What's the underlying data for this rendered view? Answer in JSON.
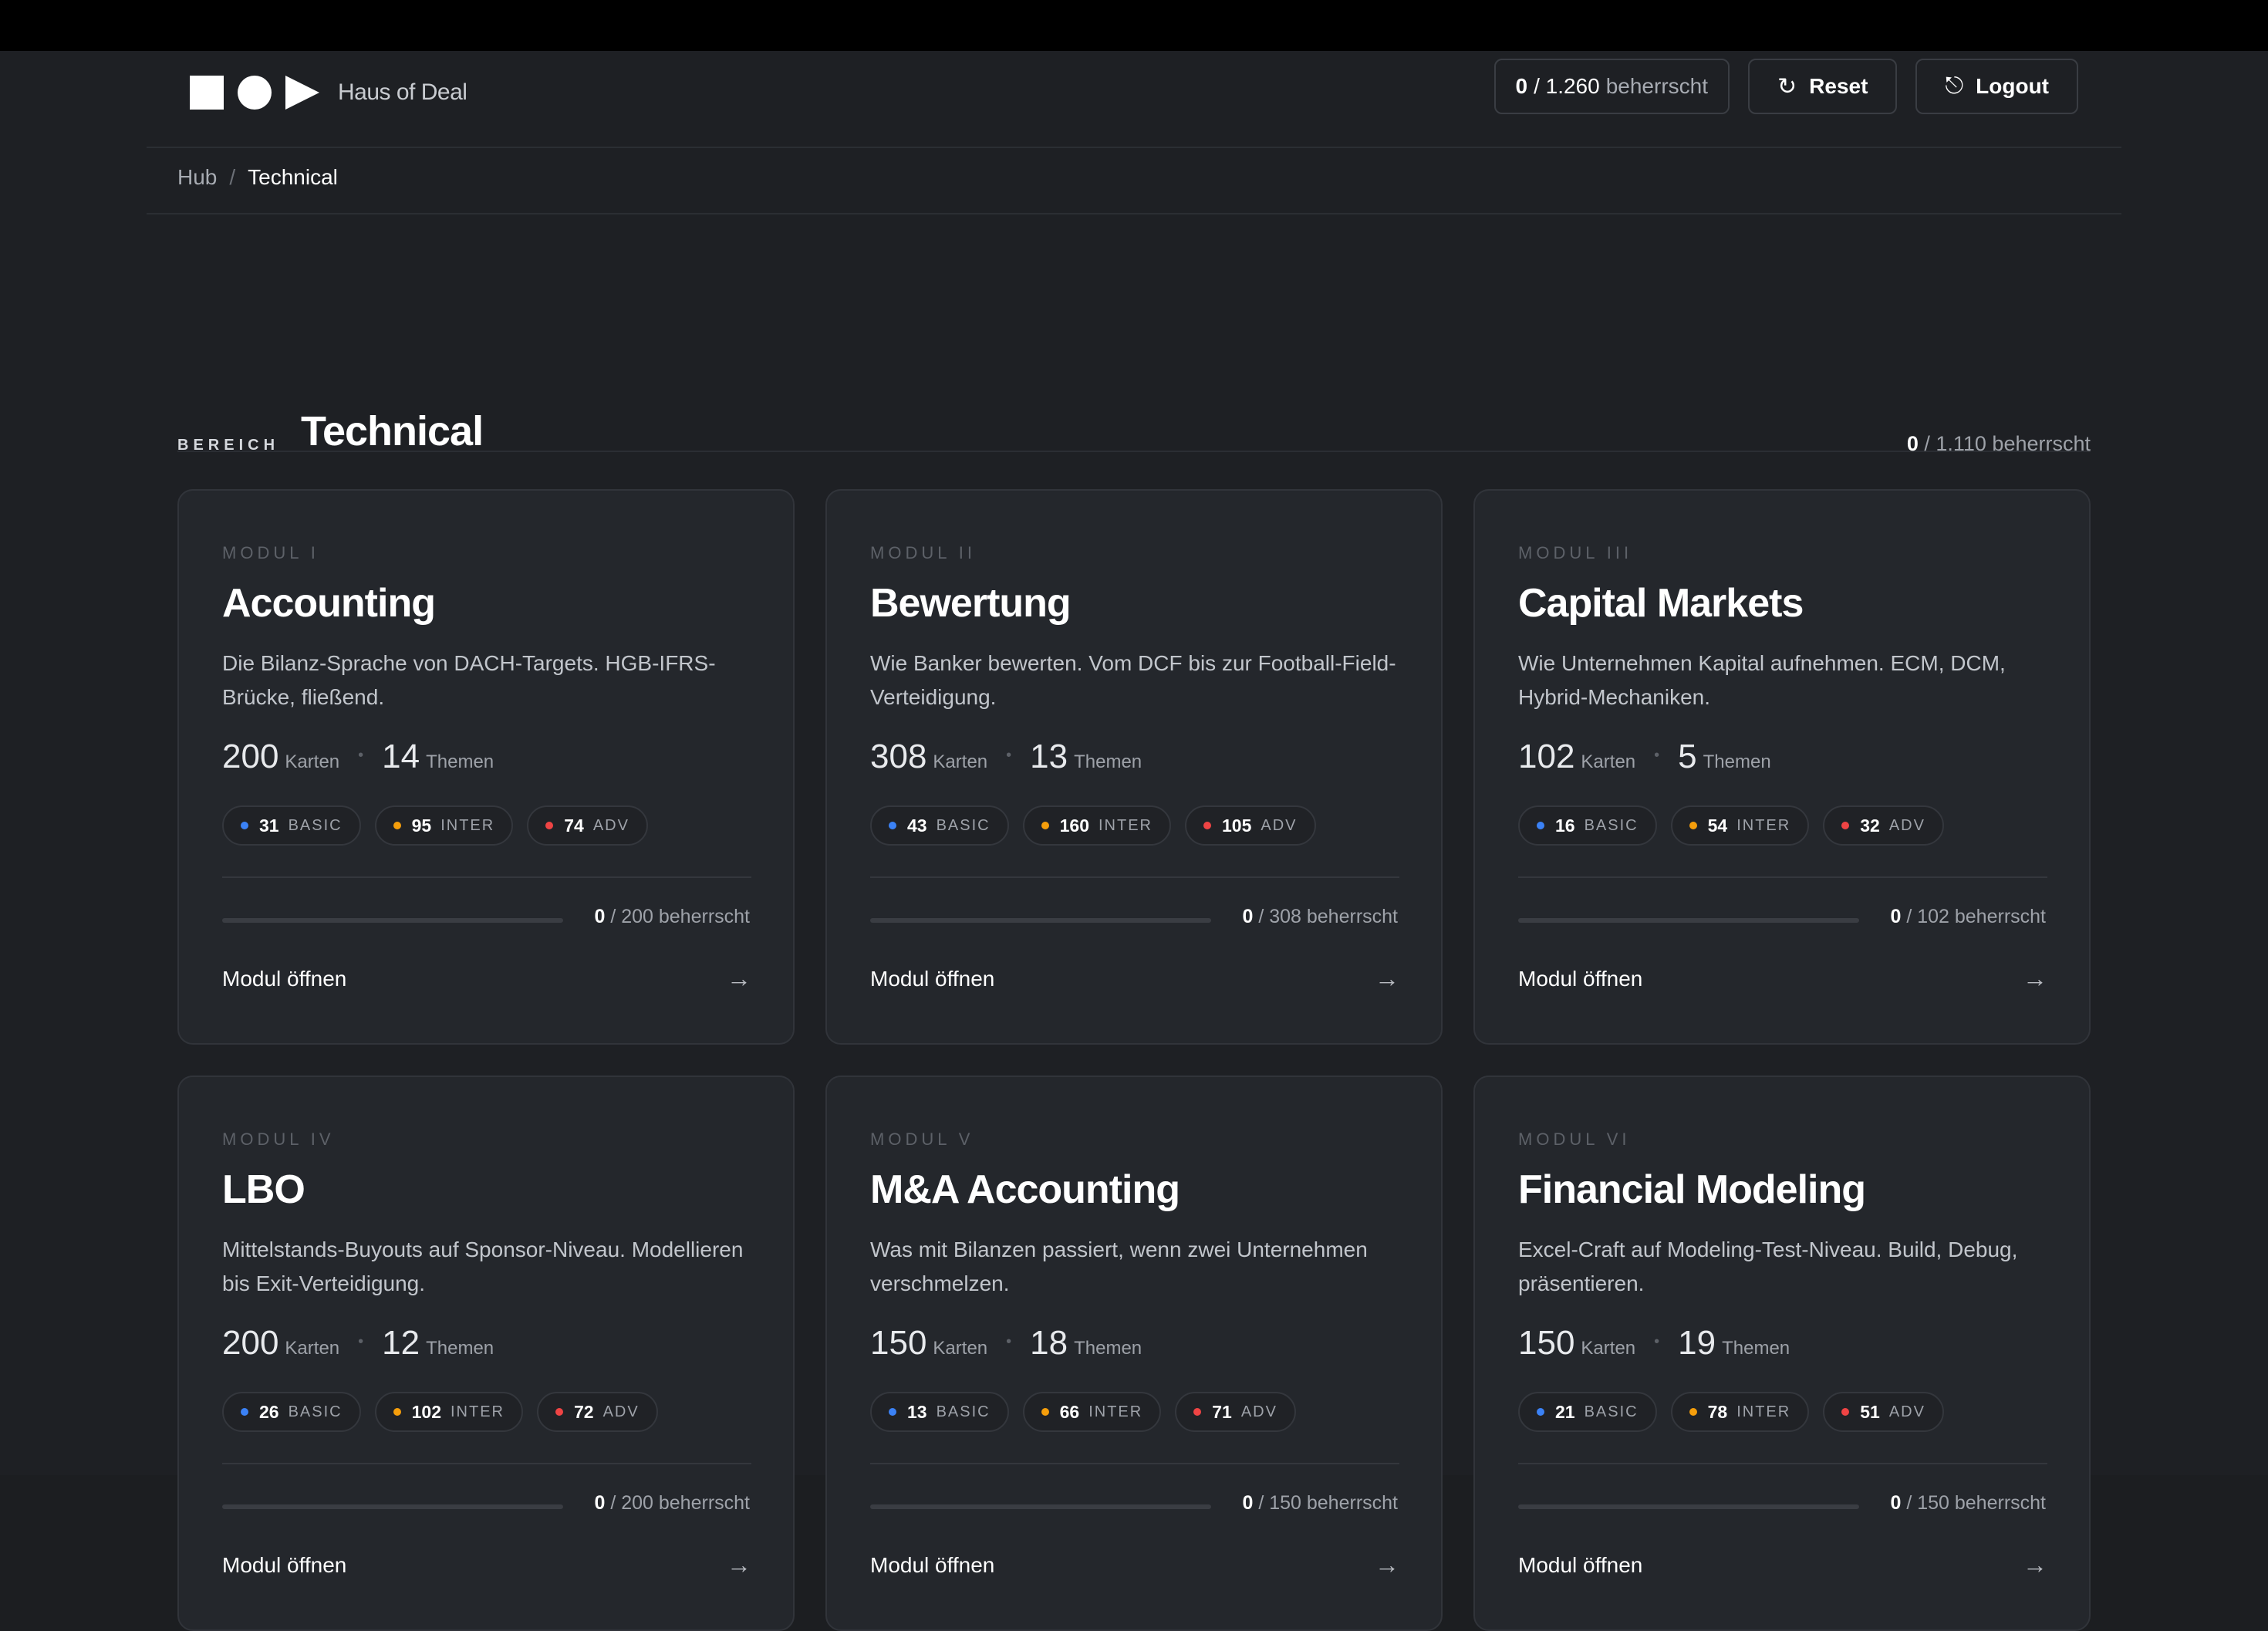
{
  "brand": {
    "name": "Haus of Deal"
  },
  "header": {
    "mastery_count": "0",
    "mastery_total": "/ 1.260",
    "mastery_suffix": "beherrscht",
    "reset_label": "Reset",
    "reset_icon": "↻",
    "logout_label": "Logout",
    "logout_icon": "⎋"
  },
  "breadcrumb": {
    "root": "Hub",
    "separator": "/",
    "current": "Technical"
  },
  "section": {
    "kicker": "BEREICH",
    "title": "Technical",
    "count": "0",
    "count_rest": "/ 1.110 beherrscht"
  },
  "colors": {
    "basic": "#3b82f6",
    "inter": "#f59e0b",
    "adv": "#ef4444"
  },
  "labels": {
    "cards": "Karten",
    "topics": "Themen",
    "basic": "BASIC",
    "inter": "INTER",
    "adv": "ADV",
    "open": "Modul öffnen",
    "arrow": "→",
    "dot": "•"
  },
  "modules": [
    {
      "kicker": "MODUL I",
      "title": "Accounting",
      "description": "Die Bilanz-Sprache von DACH-Targets. HGB-IFRS-Brücke, fließend.",
      "cards": "200",
      "topics": "14",
      "basic": "31",
      "inter": "95",
      "adv": "74",
      "mastered": "0",
      "progress_text": "/ 200 beherrscht",
      "progress": 0
    },
    {
      "kicker": "MODUL II",
      "title": "Bewertung",
      "description": "Wie Banker bewerten. Vom DCF bis zur Football-Field-Verteidigung.",
      "cards": "308",
      "topics": "13",
      "basic": "43",
      "inter": "160",
      "adv": "105",
      "mastered": "0",
      "progress_text": "/ 308 beherrscht",
      "progress": 0
    },
    {
      "kicker": "MODUL III",
      "title": "Capital Markets",
      "description": "Wie Unternehmen Kapital aufnehmen. ECM, DCM, Hybrid-Mechaniken.",
      "cards": "102",
      "topics": "5",
      "basic": "16",
      "inter": "54",
      "adv": "32",
      "mastered": "0",
      "progress_text": "/ 102 beherrscht",
      "progress": 0
    },
    {
      "kicker": "MODUL IV",
      "title": "LBO",
      "description": "Mittelstands-Buyouts auf Sponsor-Niveau. Modellieren bis Exit-Verteidigung.",
      "cards": "200",
      "topics": "12",
      "basic": "26",
      "inter": "102",
      "adv": "72",
      "mastered": "0",
      "progress_text": "/ 200 beherrscht",
      "progress": 0
    },
    {
      "kicker": "MODUL V",
      "title": "M&A Accounting",
      "description": "Was mit Bilanzen passiert, wenn zwei Unternehmen verschmelzen.",
      "cards": "150",
      "topics": "18",
      "basic": "13",
      "inter": "66",
      "adv": "71",
      "mastered": "0",
      "progress_text": "/ 150 beherrscht",
      "progress": 0
    },
    {
      "kicker": "MODUL VI",
      "title": "Financial Modeling",
      "description": "Excel-Craft auf Modeling-Test-Niveau. Build, Debug, präsentieren.",
      "cards": "150",
      "topics": "19",
      "basic": "21",
      "inter": "78",
      "adv": "51",
      "mastered": "0",
      "progress_text": "/ 150 beherrscht",
      "progress": 0
    }
  ]
}
